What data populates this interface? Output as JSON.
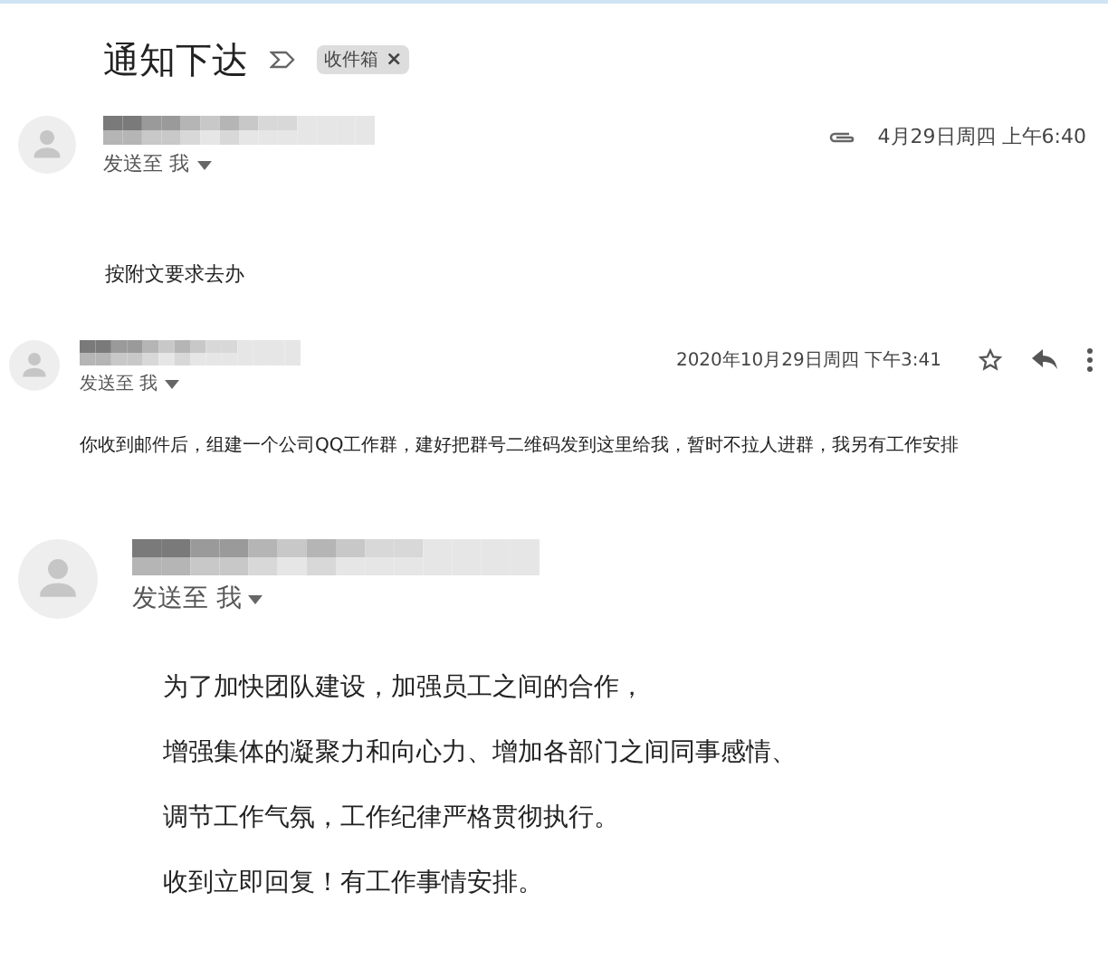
{
  "subject": "通知下达",
  "label": {
    "text": "收件箱",
    "close": "×"
  },
  "messages": [
    {
      "recipient": "发送至 我",
      "date": "4月29日周四 上午6:40",
      "has_attachment": true,
      "show_actions": false,
      "paragraphs": [
        "按附文要求去办"
      ]
    },
    {
      "recipient": "发送至 我",
      "date": "2020年10月29日周四 下午3:41",
      "has_attachment": false,
      "show_actions": true,
      "paragraphs": [
        "你收到邮件后，组建一个公司QQ工作群，建好把群号二维码发到这里给我，暂时不拉人进群，我另有工作安排"
      ]
    },
    {
      "recipient": "发送至 我",
      "has_attachment": false,
      "show_actions": false,
      "paragraphs": [
        "为了加快团队建设，加强员工之间的合作，",
        "增强集体的凝聚力和向心力、增加各部门之间同事感情、",
        "调节工作气氛，工作纪律严格贯彻执行。",
        "收到立即回复！有工作事情安排。"
      ]
    }
  ]
}
